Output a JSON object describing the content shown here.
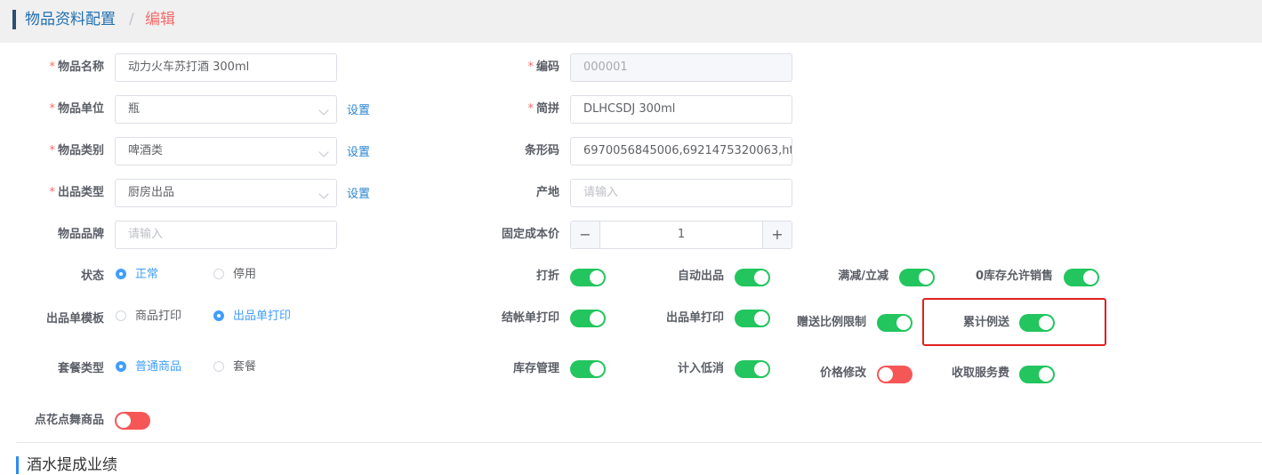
{
  "breadcrumb": {
    "parent": "物品资料配置",
    "separator": "/",
    "current": "编辑"
  },
  "form": {
    "name": {
      "label": "物品名称",
      "value": "动力火车苏打酒 300ml"
    },
    "unit": {
      "label": "物品单位",
      "value": "瓶",
      "link": "设置"
    },
    "category": {
      "label": "物品类别",
      "value": "啤酒类",
      "link": "设置"
    },
    "out_type": {
      "label": "出品类型",
      "value": "厨房出品",
      "link": "设置"
    },
    "brand": {
      "label": "物品品牌",
      "placeholder": "请输入"
    },
    "code": {
      "label": "编码",
      "value": "000001"
    },
    "pinyin": {
      "label": "简拼",
      "value": "DLHCSDJ 300ml"
    },
    "barcode": {
      "label": "条形码",
      "value": "6970056845006,6921475320063,ht"
    },
    "origin": {
      "label": "产地",
      "placeholder": "请输入"
    },
    "cost": {
      "label": "固定成本价",
      "value": "1",
      "minus": "−",
      "plus": "+"
    },
    "status": {
      "label": "状态",
      "options": [
        "正常",
        "停用"
      ],
      "selected": "正常"
    },
    "template": {
      "label": "出品单模板",
      "options": [
        "商品打印",
        "出品单打印"
      ],
      "selected": "出品单打印"
    },
    "package": {
      "label": "套餐类型",
      "options": [
        "普通商品",
        "套餐"
      ],
      "selected": "普通商品"
    },
    "dance": {
      "label": "点花点舞商品",
      "on": false
    }
  },
  "toggles": {
    "discount": {
      "label": "打折",
      "on": true
    },
    "auto_out": {
      "label": "自动出品",
      "on": true
    },
    "full_reduce": {
      "label": "满减/立减",
      "on": true
    },
    "zero_stock": {
      "label": "0库存允许销售",
      "on": true
    },
    "checkout_print": {
      "label": "结帐单打印",
      "on": true
    },
    "out_print": {
      "label": "出品单打印",
      "on": true
    },
    "gift_ratio": {
      "label": "赠送比例限制",
      "on": true
    },
    "accum_gift": {
      "label": "累计例送",
      "on": true
    },
    "stock_mgmt": {
      "label": "库存管理",
      "on": true
    },
    "min_spend": {
      "label": "计入低消",
      "on": true
    },
    "price_edit": {
      "label": "价格修改",
      "on": false
    },
    "service_fee": {
      "label": "收取服务费",
      "on": true
    }
  },
  "section": {
    "title": "酒水提成业绩"
  },
  "colors": {
    "accent": "#409eff",
    "switch_on": "#22c55e",
    "switch_off": "#f55656",
    "required": "#f56c6c",
    "highlight": "#e02020"
  }
}
